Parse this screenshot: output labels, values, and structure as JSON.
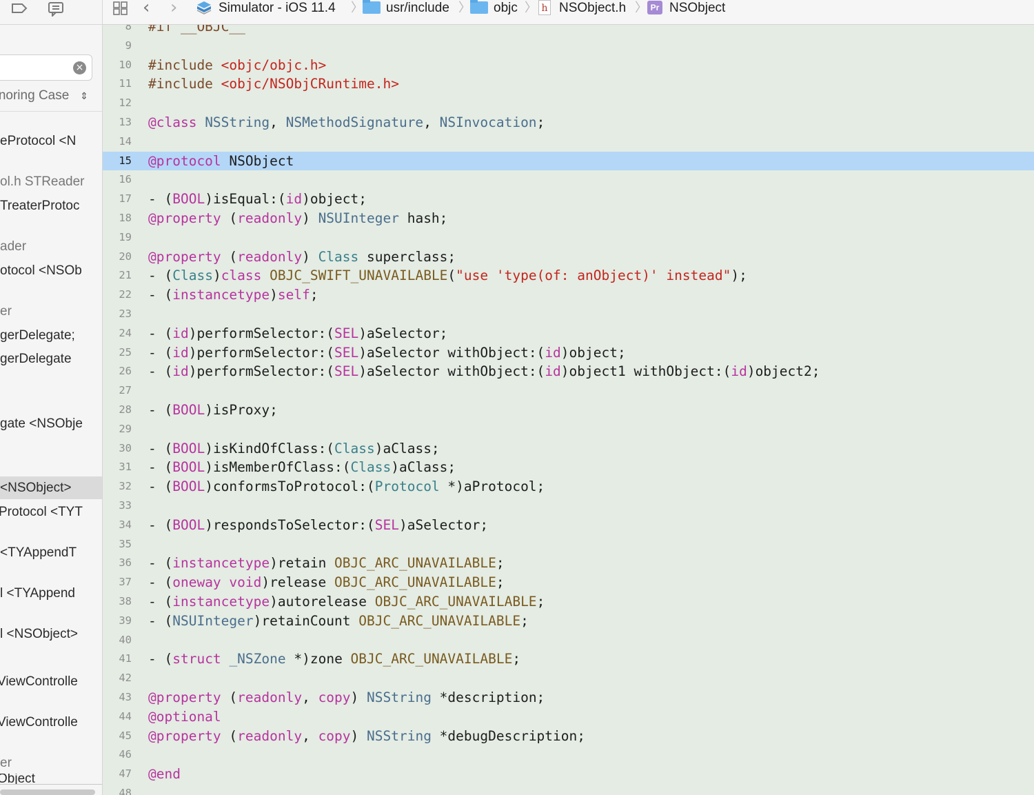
{
  "sidebar": {
    "search": {
      "value": ""
    },
    "case_option": "Ignoring Case",
    "items": [
      {
        "text": "eProtocol <N",
        "dim": false
      },
      {
        "text": "ol.h STReader",
        "dim": true
      },
      {
        "text": "TreaterProtoc",
        "dim": false
      },
      {
        "text": "ader",
        "dim": true
      },
      {
        "text": "otocol <NSOb",
        "dim": false
      },
      {
        "text": "er",
        "dim": true
      },
      {
        "text": "gerDelegate;",
        "dim": false
      },
      {
        "text": "gerDelegate",
        "dim": false
      },
      {
        "text": "gate <NSObje",
        "dim": false
      },
      {
        "text": " <NSObject>",
        "dim": false,
        "selected": true
      },
      {
        "text": "Protocol <TYT",
        "dim": false
      },
      {
        "text": " <TYAppendT",
        "dim": false
      },
      {
        "text": "l <TYAppend",
        "dim": false
      },
      {
        "text": "l <NSObject>",
        "dim": false
      },
      {
        "text": "ViewControlle",
        "dim": false
      },
      {
        "text": "ViewControlle",
        "dim": false
      },
      {
        "text": "er",
        "dim": true
      },
      {
        "text": "Object",
        "dim": false
      }
    ]
  },
  "jumpbar": {
    "scheme": "Simulator - iOS 11.4",
    "crumbs": [
      "usr/include",
      "objc",
      "NSObject.h",
      "NSObject"
    ],
    "h_icon_letter": "h",
    "protocol_icon_letter": "Pr",
    "separator": "〉",
    "back_glyph": "‹",
    "forward_glyph": "›"
  },
  "editor": {
    "current_line": 15,
    "lines": [
      {
        "n": 8,
        "tokens": [
          [
            "dir",
            "#if __OBJC__"
          ]
        ]
      },
      {
        "n": 9,
        "tokens": []
      },
      {
        "n": 10,
        "tokens": [
          [
            "dir",
            "#include "
          ],
          [
            "str",
            "<objc/objc.h>"
          ]
        ]
      },
      {
        "n": 11,
        "tokens": [
          [
            "dir",
            "#include "
          ],
          [
            "str",
            "<objc/NSObjCRuntime.h>"
          ]
        ]
      },
      {
        "n": 12,
        "tokens": []
      },
      {
        "n": 13,
        "tokens": [
          [
            "kw",
            "@class "
          ],
          [
            "type",
            "NSString"
          ],
          [
            "punc",
            ", "
          ],
          [
            "type",
            "NSMethodSignature"
          ],
          [
            "punc",
            ", "
          ],
          [
            "type",
            "NSInvocation"
          ],
          [
            "punc",
            ";"
          ]
        ]
      },
      {
        "n": 14,
        "tokens": []
      },
      {
        "n": 15,
        "tokens": [
          [
            "kw",
            "@protocol "
          ],
          [
            "plain",
            "NSObject"
          ]
        ]
      },
      {
        "n": 16,
        "tokens": []
      },
      {
        "n": 17,
        "tokens": [
          [
            "plain",
            "- ("
          ],
          [
            "kw",
            "BOOL"
          ],
          [
            "plain",
            ")isEqual:("
          ],
          [
            "kw",
            "id"
          ],
          [
            "plain",
            ")object;"
          ]
        ]
      },
      {
        "n": 18,
        "tokens": [
          [
            "kw",
            "@property "
          ],
          [
            "plain",
            "("
          ],
          [
            "kw",
            "readonly"
          ],
          [
            "plain",
            ") "
          ],
          [
            "type",
            "NSUInteger"
          ],
          [
            "plain",
            " hash;"
          ]
        ]
      },
      {
        "n": 19,
        "tokens": []
      },
      {
        "n": 20,
        "tokens": [
          [
            "kw",
            "@property "
          ],
          [
            "plain",
            "("
          ],
          [
            "kw",
            "readonly"
          ],
          [
            "plain",
            ") "
          ],
          [
            "cls",
            "Class"
          ],
          [
            "plain",
            " superclass;"
          ]
        ]
      },
      {
        "n": 21,
        "tokens": [
          [
            "plain",
            "- ("
          ],
          [
            "cls",
            "Class"
          ],
          [
            "plain",
            ")"
          ],
          [
            "kw",
            "class"
          ],
          [
            "plain",
            " "
          ],
          [
            "mac",
            "OBJC_SWIFT_UNAVAILABLE"
          ],
          [
            "plain",
            "("
          ],
          [
            "str",
            "\"use 'type(of: anObject)' instead\""
          ],
          [
            "plain",
            ");"
          ]
        ]
      },
      {
        "n": 22,
        "tokens": [
          [
            "plain",
            "- ("
          ],
          [
            "kw",
            "instancetype"
          ],
          [
            "plain",
            ")"
          ],
          [
            "kw",
            "self"
          ],
          [
            "plain",
            ";"
          ]
        ]
      },
      {
        "n": 23,
        "tokens": []
      },
      {
        "n": 24,
        "tokens": [
          [
            "plain",
            "- ("
          ],
          [
            "kw",
            "id"
          ],
          [
            "plain",
            ")performSelector:("
          ],
          [
            "kw",
            "SEL"
          ],
          [
            "plain",
            ")aSelector;"
          ]
        ]
      },
      {
        "n": 25,
        "tokens": [
          [
            "plain",
            "- ("
          ],
          [
            "kw",
            "id"
          ],
          [
            "plain",
            ")performSelector:("
          ],
          [
            "kw",
            "SEL"
          ],
          [
            "plain",
            ")aSelector withObject:("
          ],
          [
            "kw",
            "id"
          ],
          [
            "plain",
            ")object;"
          ]
        ]
      },
      {
        "n": 26,
        "tokens": [
          [
            "plain",
            "- ("
          ],
          [
            "kw",
            "id"
          ],
          [
            "plain",
            ")performSelector:("
          ],
          [
            "kw",
            "SEL"
          ],
          [
            "plain",
            ")aSelector withObject:("
          ],
          [
            "kw",
            "id"
          ],
          [
            "plain",
            ")object1 withObject:("
          ],
          [
            "kw",
            "id"
          ],
          [
            "plain",
            ")object2;"
          ]
        ]
      },
      {
        "n": 27,
        "tokens": []
      },
      {
        "n": 28,
        "tokens": [
          [
            "plain",
            "- ("
          ],
          [
            "kw",
            "BOOL"
          ],
          [
            "plain",
            ")isProxy;"
          ]
        ]
      },
      {
        "n": 29,
        "tokens": []
      },
      {
        "n": 30,
        "tokens": [
          [
            "plain",
            "- ("
          ],
          [
            "kw",
            "BOOL"
          ],
          [
            "plain",
            ")isKindOfClass:("
          ],
          [
            "cls",
            "Class"
          ],
          [
            "plain",
            ")aClass;"
          ]
        ]
      },
      {
        "n": 31,
        "tokens": [
          [
            "plain",
            "- ("
          ],
          [
            "kw",
            "BOOL"
          ],
          [
            "plain",
            ")isMemberOfClass:("
          ],
          [
            "cls",
            "Class"
          ],
          [
            "plain",
            ")aClass;"
          ]
        ]
      },
      {
        "n": 32,
        "tokens": [
          [
            "plain",
            "- ("
          ],
          [
            "kw",
            "BOOL"
          ],
          [
            "plain",
            ")conformsToProtocol:("
          ],
          [
            "cls",
            "Protocol"
          ],
          [
            "plain",
            " *)aProtocol;"
          ]
        ]
      },
      {
        "n": 33,
        "tokens": []
      },
      {
        "n": 34,
        "tokens": [
          [
            "plain",
            "- ("
          ],
          [
            "kw",
            "BOOL"
          ],
          [
            "plain",
            ")respondsToSelector:("
          ],
          [
            "kw",
            "SEL"
          ],
          [
            "plain",
            ")aSelector;"
          ]
        ]
      },
      {
        "n": 35,
        "tokens": []
      },
      {
        "n": 36,
        "tokens": [
          [
            "plain",
            "- ("
          ],
          [
            "kw",
            "instancetype"
          ],
          [
            "plain",
            ")retain "
          ],
          [
            "mac",
            "OBJC_ARC_UNAVAILABLE"
          ],
          [
            "plain",
            ";"
          ]
        ]
      },
      {
        "n": 37,
        "tokens": [
          [
            "plain",
            "- ("
          ],
          [
            "kw",
            "oneway void"
          ],
          [
            "plain",
            ")release "
          ],
          [
            "mac",
            "OBJC_ARC_UNAVAILABLE"
          ],
          [
            "plain",
            ";"
          ]
        ]
      },
      {
        "n": 38,
        "tokens": [
          [
            "plain",
            "- ("
          ],
          [
            "kw",
            "instancetype"
          ],
          [
            "plain",
            ")autorelease "
          ],
          [
            "mac",
            "OBJC_ARC_UNAVAILABLE"
          ],
          [
            "plain",
            ";"
          ]
        ]
      },
      {
        "n": 39,
        "tokens": [
          [
            "plain",
            "- ("
          ],
          [
            "type",
            "NSUInteger"
          ],
          [
            "plain",
            ")retainCount "
          ],
          [
            "mac",
            "OBJC_ARC_UNAVAILABLE"
          ],
          [
            "plain",
            ";"
          ]
        ]
      },
      {
        "n": 40,
        "tokens": []
      },
      {
        "n": 41,
        "tokens": [
          [
            "plain",
            "- ("
          ],
          [
            "kw",
            "struct"
          ],
          [
            "plain",
            " "
          ],
          [
            "type",
            "_NSZone"
          ],
          [
            "plain",
            " *)zone "
          ],
          [
            "mac",
            "OBJC_ARC_UNAVAILABLE"
          ],
          [
            "plain",
            ";"
          ]
        ]
      },
      {
        "n": 42,
        "tokens": []
      },
      {
        "n": 43,
        "tokens": [
          [
            "kw",
            "@property "
          ],
          [
            "plain",
            "("
          ],
          [
            "kw",
            "readonly"
          ],
          [
            "plain",
            ", "
          ],
          [
            "kw",
            "copy"
          ],
          [
            "plain",
            ") "
          ],
          [
            "type",
            "NSString"
          ],
          [
            "plain",
            " *description;"
          ]
        ]
      },
      {
        "n": 44,
        "tokens": [
          [
            "kw",
            "@optional"
          ]
        ]
      },
      {
        "n": 45,
        "tokens": [
          [
            "kw",
            "@property "
          ],
          [
            "plain",
            "("
          ],
          [
            "kw",
            "readonly"
          ],
          [
            "plain",
            ", "
          ],
          [
            "kw",
            "copy"
          ],
          [
            "plain",
            ") "
          ],
          [
            "type",
            "NSString"
          ],
          [
            "plain",
            " *debugDescription;"
          ]
        ]
      },
      {
        "n": 46,
        "tokens": []
      },
      {
        "n": 47,
        "tokens": [
          [
            "kw",
            "@end"
          ]
        ]
      },
      {
        "n": 48,
        "tokens": []
      }
    ]
  }
}
